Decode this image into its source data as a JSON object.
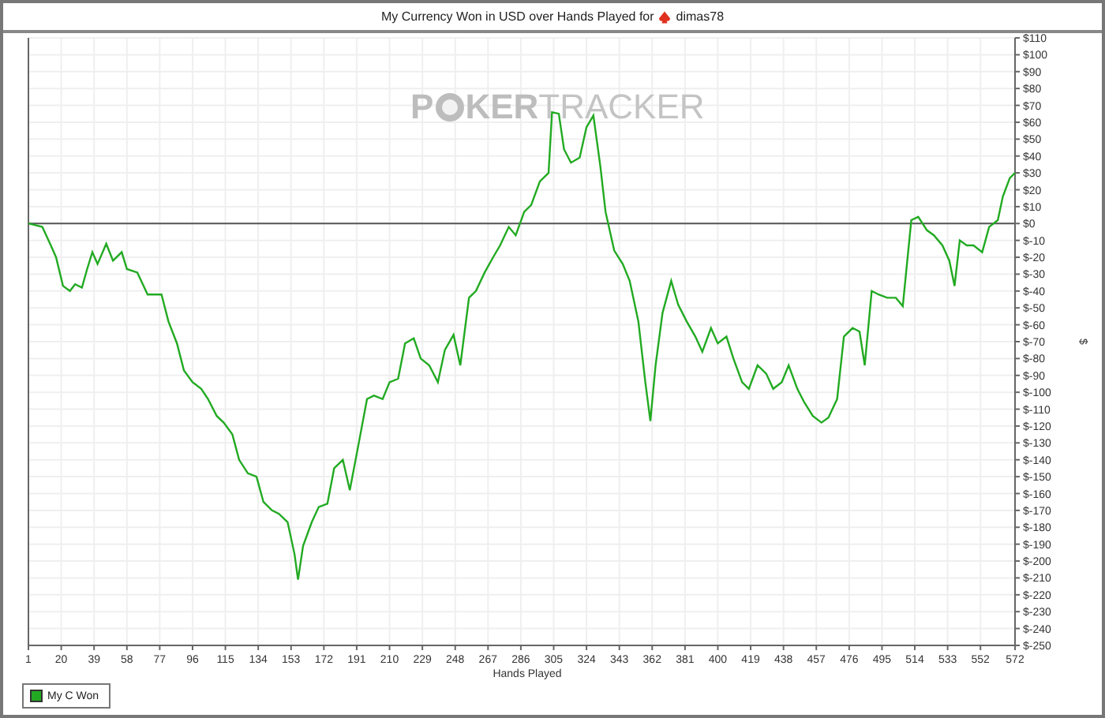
{
  "chart_panel": {
    "player_name": "dimas78",
    "watermark": [
      "P",
      "KER",
      "TRACKER"
    ],
    "chart_data": {
      "type": "line",
      "title": "My Currency Won in USD over Hands Played for",
      "xlabel": "Hands Played",
      "ylabel": "$",
      "x": [
        1,
        9,
        14,
        17,
        21,
        25,
        28,
        32,
        35,
        38,
        41,
        46,
        50,
        55,
        58,
        64,
        70,
        78,
        82,
        87,
        91,
        96,
        101,
        105,
        110,
        114,
        119,
        123,
        128,
        133,
        137,
        142,
        146,
        151,
        155,
        157,
        160,
        165,
        169,
        174,
        178,
        183,
        187,
        192,
        197,
        201,
        206,
        210,
        215,
        219,
        224,
        228,
        233,
        238,
        242,
        247,
        251,
        256,
        260,
        265,
        270,
        274,
        279,
        283,
        288,
        292,
        297,
        302,
        304,
        308,
        311,
        315,
        320,
        324,
        328,
        332,
        335,
        340,
        345,
        349,
        354,
        358,
        361,
        364,
        368,
        373,
        377,
        382,
        387,
        391,
        396,
        400,
        405,
        409,
        414,
        418,
        423,
        428,
        432,
        437,
        441,
        446,
        450,
        455,
        460,
        464,
        469,
        473,
        478,
        482,
        485,
        489,
        493,
        498,
        503,
        507,
        512,
        516,
        521,
        525,
        530,
        534,
        537,
        540,
        544,
        548,
        553,
        557,
        562,
        565,
        569,
        572
      ],
      "series": [
        {
          "name": "My C Won",
          "color": "#22aa22",
          "values": [
            0,
            -2,
            -13,
            -20,
            -37,
            -40,
            -36,
            -38,
            -27,
            -17,
            -24,
            -12,
            -22,
            -17,
            -27,
            -29,
            -42,
            -42,
            -58,
            -71,
            -87,
            -94,
            -98,
            -104,
            -114,
            -118,
            -125,
            -140,
            -148,
            -150,
            -165,
            -170,
            -172,
            -177,
            -196,
            -211,
            -191,
            -177,
            -168,
            -166,
            -145,
            -140,
            -158,
            -131,
            -104,
            -102,
            -104,
            -94,
            -92,
            -71,
            -68,
            -80,
            -84,
            -94,
            -75,
            -66,
            -84,
            -44,
            -40,
            -29,
            -20,
            -13,
            -2,
            -7,
            7,
            11,
            25,
            30,
            66,
            65,
            44,
            36,
            39,
            57,
            64,
            34,
            7,
            -16,
            -24,
            -34,
            -58,
            -94,
            -117,
            -84,
            -53,
            -34,
            -48,
            -58,
            -67,
            -76,
            -62,
            -71,
            -67,
            -80,
            -94,
            -98,
            -84,
            -89,
            -98,
            -94,
            -84,
            -98,
            -106,
            -114,
            -118,
            -115,
            -104,
            -67,
            -62,
            -64,
            -84,
            -40,
            -42,
            -44,
            -44,
            -49,
            2,
            4,
            -4,
            -7,
            -13,
            -22,
            -37,
            -10,
            -13,
            -13,
            -17,
            -2,
            2,
            16,
            27,
            30
          ]
        }
      ],
      "grid": true,
      "xlim": [
        1,
        572
      ],
      "ylim": [
        -250,
        110
      ],
      "xticks": [
        1,
        20,
        39,
        58,
        77,
        96,
        115,
        134,
        153,
        172,
        191,
        210,
        229,
        248,
        267,
        286,
        305,
        324,
        343,
        362,
        381,
        400,
        419,
        438,
        457,
        476,
        495,
        514,
        533,
        552,
        572
      ],
      "yticks": [
        {
          "value": 110,
          "label": "$110"
        },
        {
          "value": 100,
          "label": "$100"
        },
        {
          "value": 90,
          "label": "$90"
        },
        {
          "value": 80,
          "label": "$80"
        },
        {
          "value": 70,
          "label": "$70"
        },
        {
          "value": 60,
          "label": "$60"
        },
        {
          "value": 50,
          "label": "$50"
        },
        {
          "value": 40,
          "label": "$40"
        },
        {
          "value": 30,
          "label": "$30"
        },
        {
          "value": 20,
          "label": "$20"
        },
        {
          "value": 10,
          "label": "$10"
        },
        {
          "value": 0,
          "label": "$0"
        },
        {
          "value": -10,
          "label": "$-10"
        },
        {
          "value": -20,
          "label": "$-20"
        },
        {
          "value": -30,
          "label": "$-30"
        },
        {
          "value": -40,
          "label": "$-40"
        },
        {
          "value": -50,
          "label": "$-50"
        },
        {
          "value": -60,
          "label": "$-60"
        },
        {
          "value": -70,
          "label": "$-70"
        },
        {
          "value": -80,
          "label": "$-80"
        },
        {
          "value": -90,
          "label": "$-90"
        },
        {
          "value": -100,
          "label": "$-100"
        },
        {
          "value": -110,
          "label": "$-110"
        },
        {
          "value": -120,
          "label": "$-120"
        },
        {
          "value": -130,
          "label": "$-130"
        },
        {
          "value": -140,
          "label": "$-140"
        },
        {
          "value": -150,
          "label": "$-150"
        },
        {
          "value": -160,
          "label": "$-160"
        },
        {
          "value": -170,
          "label": "$-170"
        },
        {
          "value": -180,
          "label": "$-180"
        },
        {
          "value": -190,
          "label": "$-190"
        },
        {
          "value": -200,
          "label": "$-200"
        },
        {
          "value": -210,
          "label": "$-210"
        },
        {
          "value": -220,
          "label": "$-220"
        },
        {
          "value": -230,
          "label": "$-230"
        },
        {
          "value": -240,
          "label": "$-240"
        },
        {
          "value": -250,
          "label": "$-250"
        }
      ]
    }
  }
}
